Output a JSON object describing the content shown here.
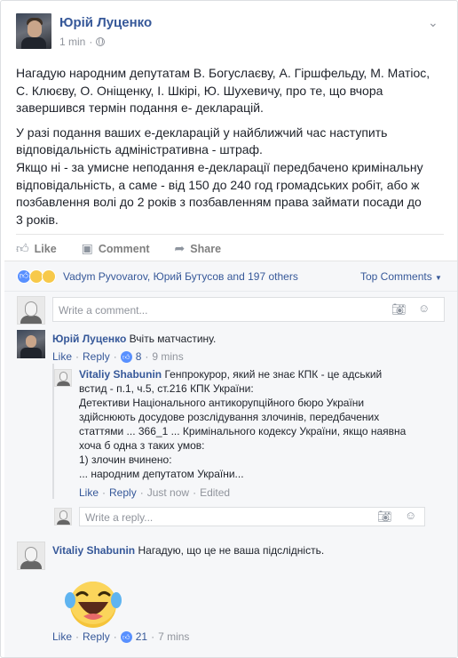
{
  "post": {
    "author": "Юрій Луценко",
    "time": "1 min",
    "menu_icon": "chevron-down-icon",
    "paragraph1_lines": [
      "Нагадую народним депутатам В. Богуслаєву, А. Гіршфельду, М. Матіос,",
      "С. Клюєву, О. Оніщенку, І. Шкірі, Ю. Шухевичу, про те, що вчора",
      "завершився термін подання е- декларацій."
    ],
    "paragraph2_lines": [
      "У разі подання ваших е-декларацій у найближчий час наступить",
      "відповідальність адміністративна - штраф.",
      "Якщо ні - за умисне неподання е-декларації передбачено кримінальну",
      "відповідальність, а саме - від 150 до 240 год громадських робіт, або ж",
      "позбавлення волі до 2 років з позбавленням права займати посади до",
      "3 років."
    ]
  },
  "actions": {
    "like": "Like",
    "comment": "Comment",
    "share": "Share"
  },
  "reactions": {
    "names": "Vadym Pyvovarov, Юрий Бутусов and 197 others",
    "sort": "Top Comments"
  },
  "composer": {
    "placeholder": "Write a comment...",
    "reply_placeholder": "Write a reply..."
  },
  "comments": [
    {
      "author": "Юрій Луценко",
      "text": "Вчіть матчастину.",
      "like": "Like",
      "reply": "Reply",
      "likes": "8",
      "time": "9 mins"
    },
    {
      "author": "Vitaliy Shabunin",
      "text_lines": [
        "Генпрокурор, який не знає КПК - це адський",
        "встид - п.1, ч.5, ст.216 КПК України:",
        "Детективи Національного антикорупційного бюро України",
        "здійснюють досудове розслідування злочинів, передбачених",
        "статтями ... 366_1 ... Кримінального кодексу України, якщо наявна",
        "хоча б одна з таких умов:",
        "1) злочин вчинено:",
        "... народним депутатом України..."
      ],
      "like": "Like",
      "reply": "Reply",
      "time": "Just now",
      "edited": "Edited"
    },
    {
      "author": "Vitaliy Shabunin",
      "text": "Нагадую, що це не ваша підслідність.",
      "like": "Like",
      "reply": "Reply",
      "likes": "21",
      "time": "7 mins"
    }
  ],
  "colors": {
    "link": "#365899",
    "muted": "#90949c",
    "like_blue": "#5890ff",
    "haha_yellow": "#f7c94a"
  }
}
